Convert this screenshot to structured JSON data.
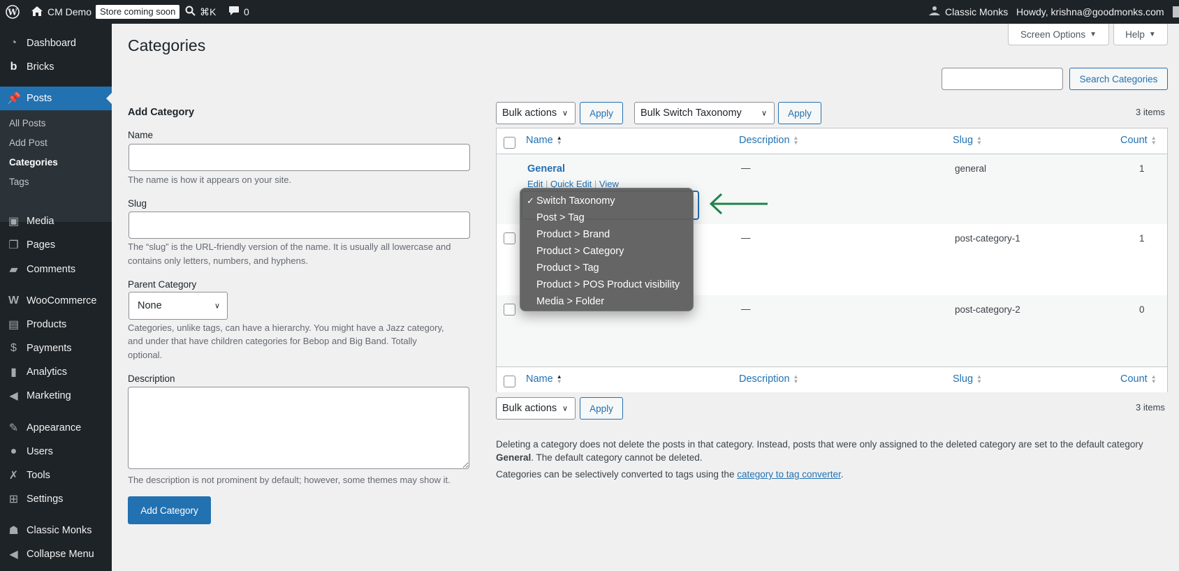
{
  "admin_bar": {
    "site_name": "CM Demo",
    "store_badge": "Store coming soon",
    "shortcut": "⌘K",
    "comments_count": "0",
    "right_plugin": "Classic Monks",
    "howdy": "Howdy, krishna@goodmonks.com"
  },
  "sidebar": {
    "items": [
      {
        "label": "Dashboard",
        "icon": "dashboard-icon"
      },
      {
        "label": "Bricks",
        "icon": "bricks-icon"
      },
      {
        "label": "Posts",
        "icon": "pin-icon"
      },
      {
        "label": "Media",
        "icon": "media-icon"
      },
      {
        "label": "Pages",
        "icon": "pages-icon"
      },
      {
        "label": "Comments",
        "icon": "comment-icon"
      },
      {
        "label": "WooCommerce",
        "icon": "woocommerce-icon"
      },
      {
        "label": "Products",
        "icon": "products-icon"
      },
      {
        "label": "Payments",
        "icon": "payments-icon"
      },
      {
        "label": "Analytics",
        "icon": "analytics-icon"
      },
      {
        "label": "Marketing",
        "icon": "megaphone-icon"
      },
      {
        "label": "Appearance",
        "icon": "brush-icon"
      },
      {
        "label": "Users",
        "icon": "users-icon"
      },
      {
        "label": "Tools",
        "icon": "wrench-icon"
      },
      {
        "label": "Settings",
        "icon": "settings-icon"
      },
      {
        "label": "Classic Monks",
        "icon": "monk-icon"
      },
      {
        "label": "Collapse Menu",
        "icon": "collapse-icon"
      }
    ],
    "submenu": [
      "All Posts",
      "Add Post",
      "Categories",
      "Tags"
    ]
  },
  "header": {
    "title": "Categories",
    "screen_options": "Screen Options",
    "help": "Help"
  },
  "search": {
    "button": "Search Categories",
    "value": ""
  },
  "form": {
    "heading": "Add Category",
    "name_label": "Name",
    "name_help": "The name is how it appears on your site.",
    "slug_label": "Slug",
    "slug_help_1": "The “slug” is the URL-friendly version of the name. It is usually all lowercase and",
    "slug_help_2": "contains only letters, numbers, and hyphens.",
    "parent_label": "Parent Category",
    "parent_value": "None",
    "parent_help_1": "Categories, unlike tags, can have a hierarchy. You might have a Jazz category,",
    "parent_help_2": "and under that have children categories for Bebop and Big Band. Totally",
    "parent_help_3": "optional.",
    "description_label": "Description",
    "description_help": "The description is not prominent by default; however, some themes may show it.",
    "submit": "Add Category"
  },
  "toolbar": {
    "bulk_actions": "Bulk actions",
    "apply": "Apply",
    "bulk_switch": "Bulk Switch Taxonomy",
    "items_count": "3 items"
  },
  "table": {
    "columns": [
      "Name",
      "Description",
      "Slug",
      "Count"
    ],
    "rows": [
      {
        "name": "General",
        "description": "—",
        "slug": "general",
        "count": "1"
      },
      {
        "name": "",
        "description": "—",
        "slug": "post-category-1",
        "count": "1"
      },
      {
        "name": "",
        "description": "—",
        "slug": "post-category-2",
        "count": "0"
      }
    ],
    "row_actions": [
      "Edit",
      "Quick Edit",
      "View"
    ]
  },
  "dropdown": {
    "selected": "Switch Taxonomy",
    "options": [
      "Switch Taxonomy",
      "Post > Tag",
      "Product > Brand",
      "Product > Category",
      "Product > Tag",
      "Product > POS Product visibility",
      "Media > Folder"
    ]
  },
  "notes": {
    "delete_note_1": "Deleting a category does not delete the posts in that category. Instead, posts that were only assigned to the deleted category are set to the default category",
    "delete_note_bold": "General",
    "delete_note_2": ". The default category cannot be deleted.",
    "convert_prefix": "Categories can be selectively converted to tags using the ",
    "convert_link": "category to tag converter",
    "convert_suffix": "."
  },
  "colors": {
    "accent": "#2271b1",
    "annotation_arrow": "#1e8449",
    "adminbar_bg": "#1d2327"
  }
}
